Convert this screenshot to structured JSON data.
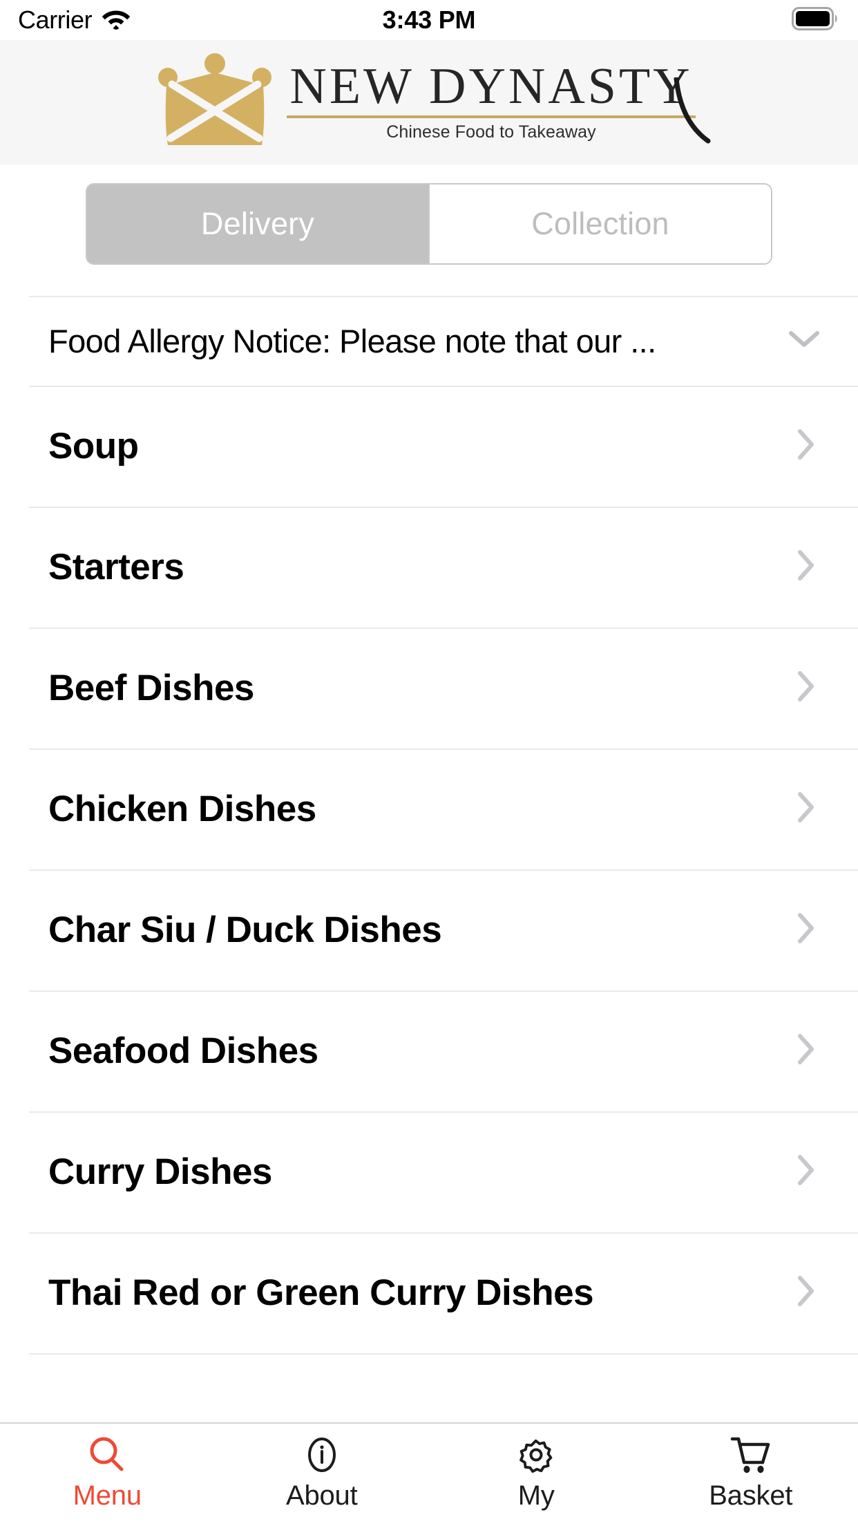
{
  "status_bar": {
    "carrier": "Carrier",
    "wifi_icon": "wifi-icon",
    "time": "3:43 PM",
    "battery_icon": "battery-full-icon"
  },
  "brand": {
    "logo_icon": "crown-logo-icon",
    "name": "NEW DYNASTY",
    "tagline": "Chinese Food to Takeaway",
    "gold_color": "#c9a961",
    "crown_color": "#d4b062",
    "header_background": "#f6f6f6"
  },
  "order_type": {
    "selected": "Delivery",
    "options": [
      {
        "label": "Delivery",
        "selected": true
      },
      {
        "label": "Collection",
        "selected": false
      }
    ],
    "selected_background": "#c2c2c2",
    "selected_text_color": "#ffffff",
    "unselected_text_color": "#bdbdbd"
  },
  "notice": {
    "text": "Food Allergy Notice: Please note that our ...",
    "expand_icon": "chevron-down-icon"
  },
  "menu": {
    "disclosure_icon": "chevron-right-icon",
    "categories": [
      {
        "label": "Soup"
      },
      {
        "label": "Starters"
      },
      {
        "label": "Beef Dishes"
      },
      {
        "label": "Chicken Dishes"
      },
      {
        "label": "Char Siu / Duck Dishes"
      },
      {
        "label": "Seafood Dishes"
      },
      {
        "label": "Curry Dishes"
      },
      {
        "label": "Thai Red or Green Curry Dishes"
      }
    ]
  },
  "tab_bar": {
    "active_color": "#ee4a36",
    "inactive_color": "#1c1c1c",
    "tabs": [
      {
        "label": "Menu",
        "icon": "search-icon",
        "active": true
      },
      {
        "label": "About",
        "icon": "info-circle-icon",
        "active": false
      },
      {
        "label": "My",
        "icon": "gear-icon",
        "active": false
      },
      {
        "label": "Basket",
        "icon": "shopping-cart-icon",
        "active": false
      }
    ]
  }
}
